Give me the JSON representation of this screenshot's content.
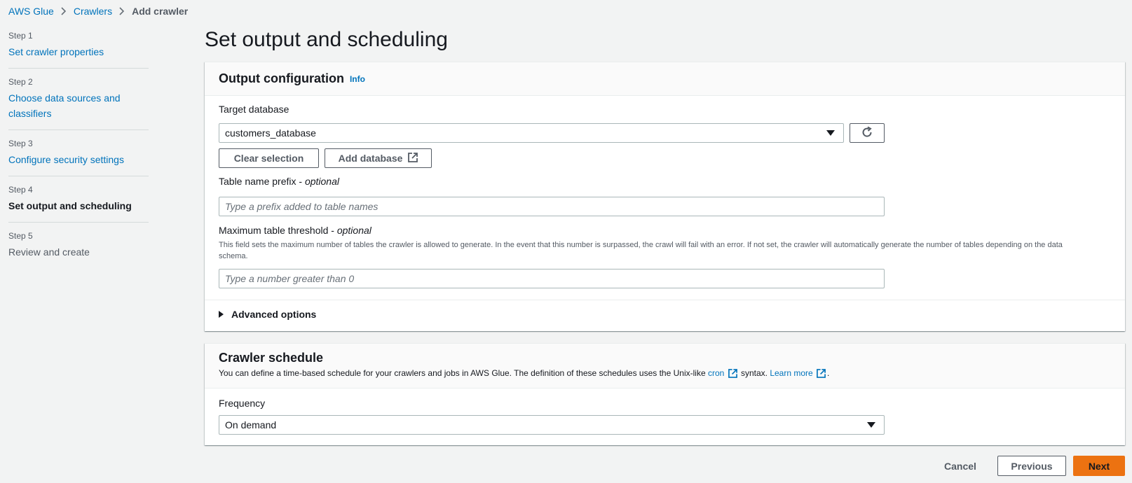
{
  "breadcrumb": {
    "items": [
      "AWS Glue",
      "Crawlers"
    ],
    "current": "Add crawler"
  },
  "steps": [
    {
      "num": "Step 1",
      "title": "Set crawler properties"
    },
    {
      "num": "Step 2",
      "title": "Choose data sources and classifiers"
    },
    {
      "num": "Step 3",
      "title": "Configure security settings"
    },
    {
      "num": "Step 4",
      "title": "Set output and scheduling"
    },
    {
      "num": "Step 5",
      "title": "Review and create"
    }
  ],
  "page_title": "Set output and scheduling",
  "output": {
    "title": "Output configuration",
    "info": "Info",
    "target_db_label": "Target database",
    "target_db_value": "customers_database",
    "clear_label": "Clear selection",
    "add_db_label": "Add database",
    "prefix_label": "Table name prefix - ",
    "optional": "optional",
    "prefix_placeholder": "Type a prefix added to table names",
    "threshold_label": "Maximum table threshold - ",
    "threshold_hint": "This field sets the maximum number of tables the crawler is allowed to generate. In the event that this number is surpassed, the crawl will fail with an error. If not set, the crawler will automatically generate the number of tables depending on the data schema.",
    "threshold_placeholder": "Type a number greater than 0",
    "advanced": "Advanced options"
  },
  "schedule": {
    "title": "Crawler schedule",
    "desc_prefix": "You can define a time-based schedule for your crawlers and jobs in AWS Glue. The definition of these schedules uses the Unix-like ",
    "cron": "cron",
    "desc_mid": " syntax. ",
    "learn_more": "Learn more",
    "desc_end": ".",
    "frequency_label": "Frequency",
    "frequency_value": "On demand"
  },
  "footer": {
    "cancel": "Cancel",
    "previous": "Previous",
    "next": "Next"
  },
  "colors": {
    "link": "#0073bb",
    "primary": "#ec7211",
    "background": "#f2f3f3"
  }
}
